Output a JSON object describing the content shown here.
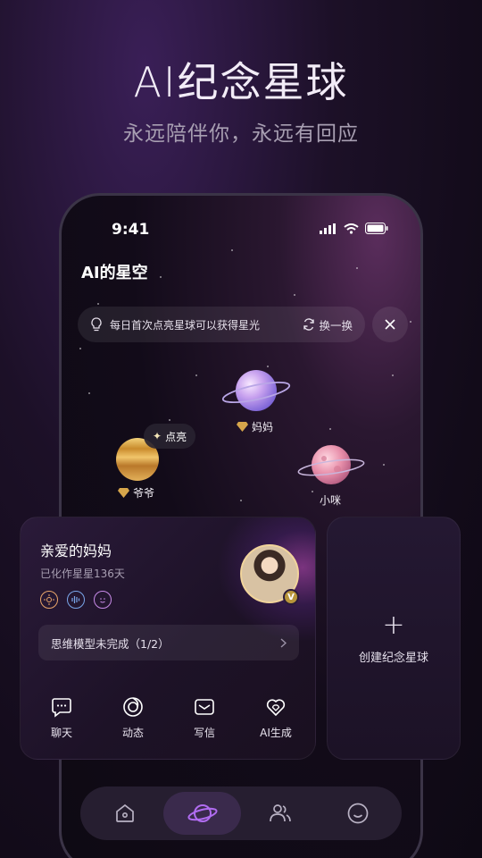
{
  "promo": {
    "title": "AI纪念星球",
    "subtitle": "永远陪伴你，永远有回应"
  },
  "status": {
    "time": "9:41"
  },
  "app": {
    "title": "AI的星空"
  },
  "tip": {
    "text": "每日首次点亮星球可以获得星光",
    "refresh_label": "换一换"
  },
  "planets": [
    {
      "name": "妈妈",
      "badge": "diamond"
    },
    {
      "name": "爷爷",
      "badge": "diamond"
    },
    {
      "name": "小咪",
      "badge": ""
    }
  ],
  "light_tag": "点亮",
  "card": {
    "title": "亲爱的妈妈",
    "days": "已化作星星136天",
    "avatar_badge": "V",
    "model_status": "思维模型未完成（1/2）",
    "actions": [
      {
        "label": "聊天",
        "icon": "chat-icon"
      },
      {
        "label": "动态",
        "icon": "moments-icon"
      },
      {
        "label": "写信",
        "icon": "mail-icon"
      },
      {
        "label": "AI生成",
        "icon": "ai-heart-icon"
      }
    ]
  },
  "create_card": {
    "label": "创建纪念星球"
  },
  "tabs": [
    {
      "name": "home-icon",
      "active": false
    },
    {
      "name": "planet-icon",
      "active": true
    },
    {
      "name": "friends-icon",
      "active": false
    },
    {
      "name": "profile-icon",
      "active": false
    }
  ],
  "colors": {
    "accent": "#b06cf0",
    "gold": "#d7a64b"
  }
}
